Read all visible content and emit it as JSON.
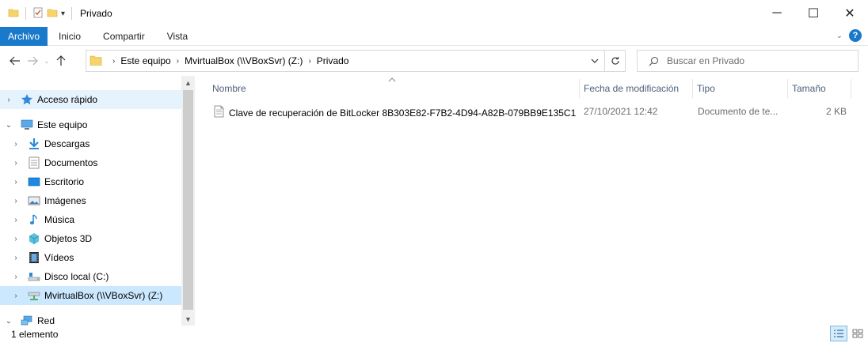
{
  "window": {
    "title": "Privado",
    "controls": {
      "minimize": "─",
      "maximize": "☐",
      "close": "✕"
    }
  },
  "ribbon": {
    "tabs": [
      {
        "label": "Archivo"
      },
      {
        "label": "Inicio"
      },
      {
        "label": "Compartir"
      },
      {
        "label": "Vista"
      }
    ],
    "help": "?"
  },
  "address": {
    "crumbs": [
      "Este equipo",
      "MvirtualBox (\\\\VBoxSvr) (Z:)",
      "Privado"
    ]
  },
  "search": {
    "placeholder": "Buscar en Privado"
  },
  "nav": {
    "items": [
      {
        "label": "Acceso rápido",
        "icon": "star-icon"
      },
      {
        "label": "Este equipo",
        "icon": "computer-icon"
      },
      {
        "label": "Descargas",
        "icon": "download-icon"
      },
      {
        "label": "Documentos",
        "icon": "documents-icon"
      },
      {
        "label": "Escritorio",
        "icon": "desktop-icon"
      },
      {
        "label": "Imágenes",
        "icon": "pictures-icon"
      },
      {
        "label": "Música",
        "icon": "music-icon"
      },
      {
        "label": "Objetos 3D",
        "icon": "objects-3d-icon"
      },
      {
        "label": "Vídeos",
        "icon": "videos-icon"
      },
      {
        "label": "Disco local (C:)",
        "icon": "drive-icon"
      },
      {
        "label": "MvirtualBox (\\\\VBoxSvr) (Z:)",
        "icon": "network-drive-icon"
      },
      {
        "label": "Red",
        "icon": "network-icon"
      }
    ]
  },
  "columns": {
    "name": "Nombre",
    "date": "Fecha de modificación",
    "type": "Tipo",
    "size": "Tamaño"
  },
  "files": [
    {
      "name": "Clave de recuperación de BitLocker 8B303E82-F7B2-4D94-A82B-079BB9E135C1",
      "date": "27/10/2021 12:42",
      "type": "Documento de te...",
      "size": "2 KB",
      "icon": "text-file-icon"
    }
  ],
  "status": {
    "count": "1 elemento"
  },
  "colors": {
    "accent": "#1979ca",
    "selection": "#cce8ff"
  }
}
